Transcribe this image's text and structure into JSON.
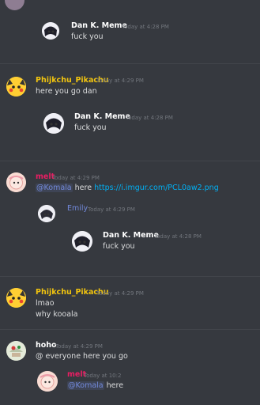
{
  "messages": [
    {
      "embed": {
        "author": "Dan K. Meme",
        "time": "Today at 4:28 PM",
        "text": "fuck you"
      }
    },
    {
      "author": "Phijkchu_Pikachu",
      "author_color": "#f1c40f",
      "time": "Today at 4:29 PM",
      "text": "here you go dan",
      "embed": {
        "author": "Dan K. Meme",
        "time": "Today at 4:28 PM",
        "text": "fuck you"
      }
    },
    {
      "author": "melt",
      "author_color": "#e91e63",
      "time": "Today at 4:29 PM",
      "mention": "@Komala",
      "text_before": "here",
      "link": "https://i.imgur.com/PCL0aw2.png",
      "embed": {
        "author": "Emily",
        "author_color": "#7289da",
        "time": "Today at 4:29 PM",
        "inner": {
          "author": "Dan K. Meme",
          "time": "Today at 4:28 PM",
          "text": "fuck you"
        }
      }
    },
    {
      "author": "Phijkchu_Pikachu",
      "author_color": "#f1c40f",
      "time": "Today at 4:29 PM",
      "lines": [
        "lmao",
        "why kooala"
      ]
    },
    {
      "author": "hoho",
      "author_color": "#ffffff",
      "time": "Today at 4:29 PM",
      "text": "@ everyone here you go",
      "embed": {
        "author": "melt",
        "author_color": "#e91e63",
        "time": "Today at 10:2",
        "mention": "@Komala",
        "text_after": "here"
      }
    }
  ],
  "colors": {
    "background": "#36393f",
    "divider": "#42454b",
    "timestamp": "#72767d",
    "mention": "#7289da",
    "link": "#00b0f4"
  }
}
